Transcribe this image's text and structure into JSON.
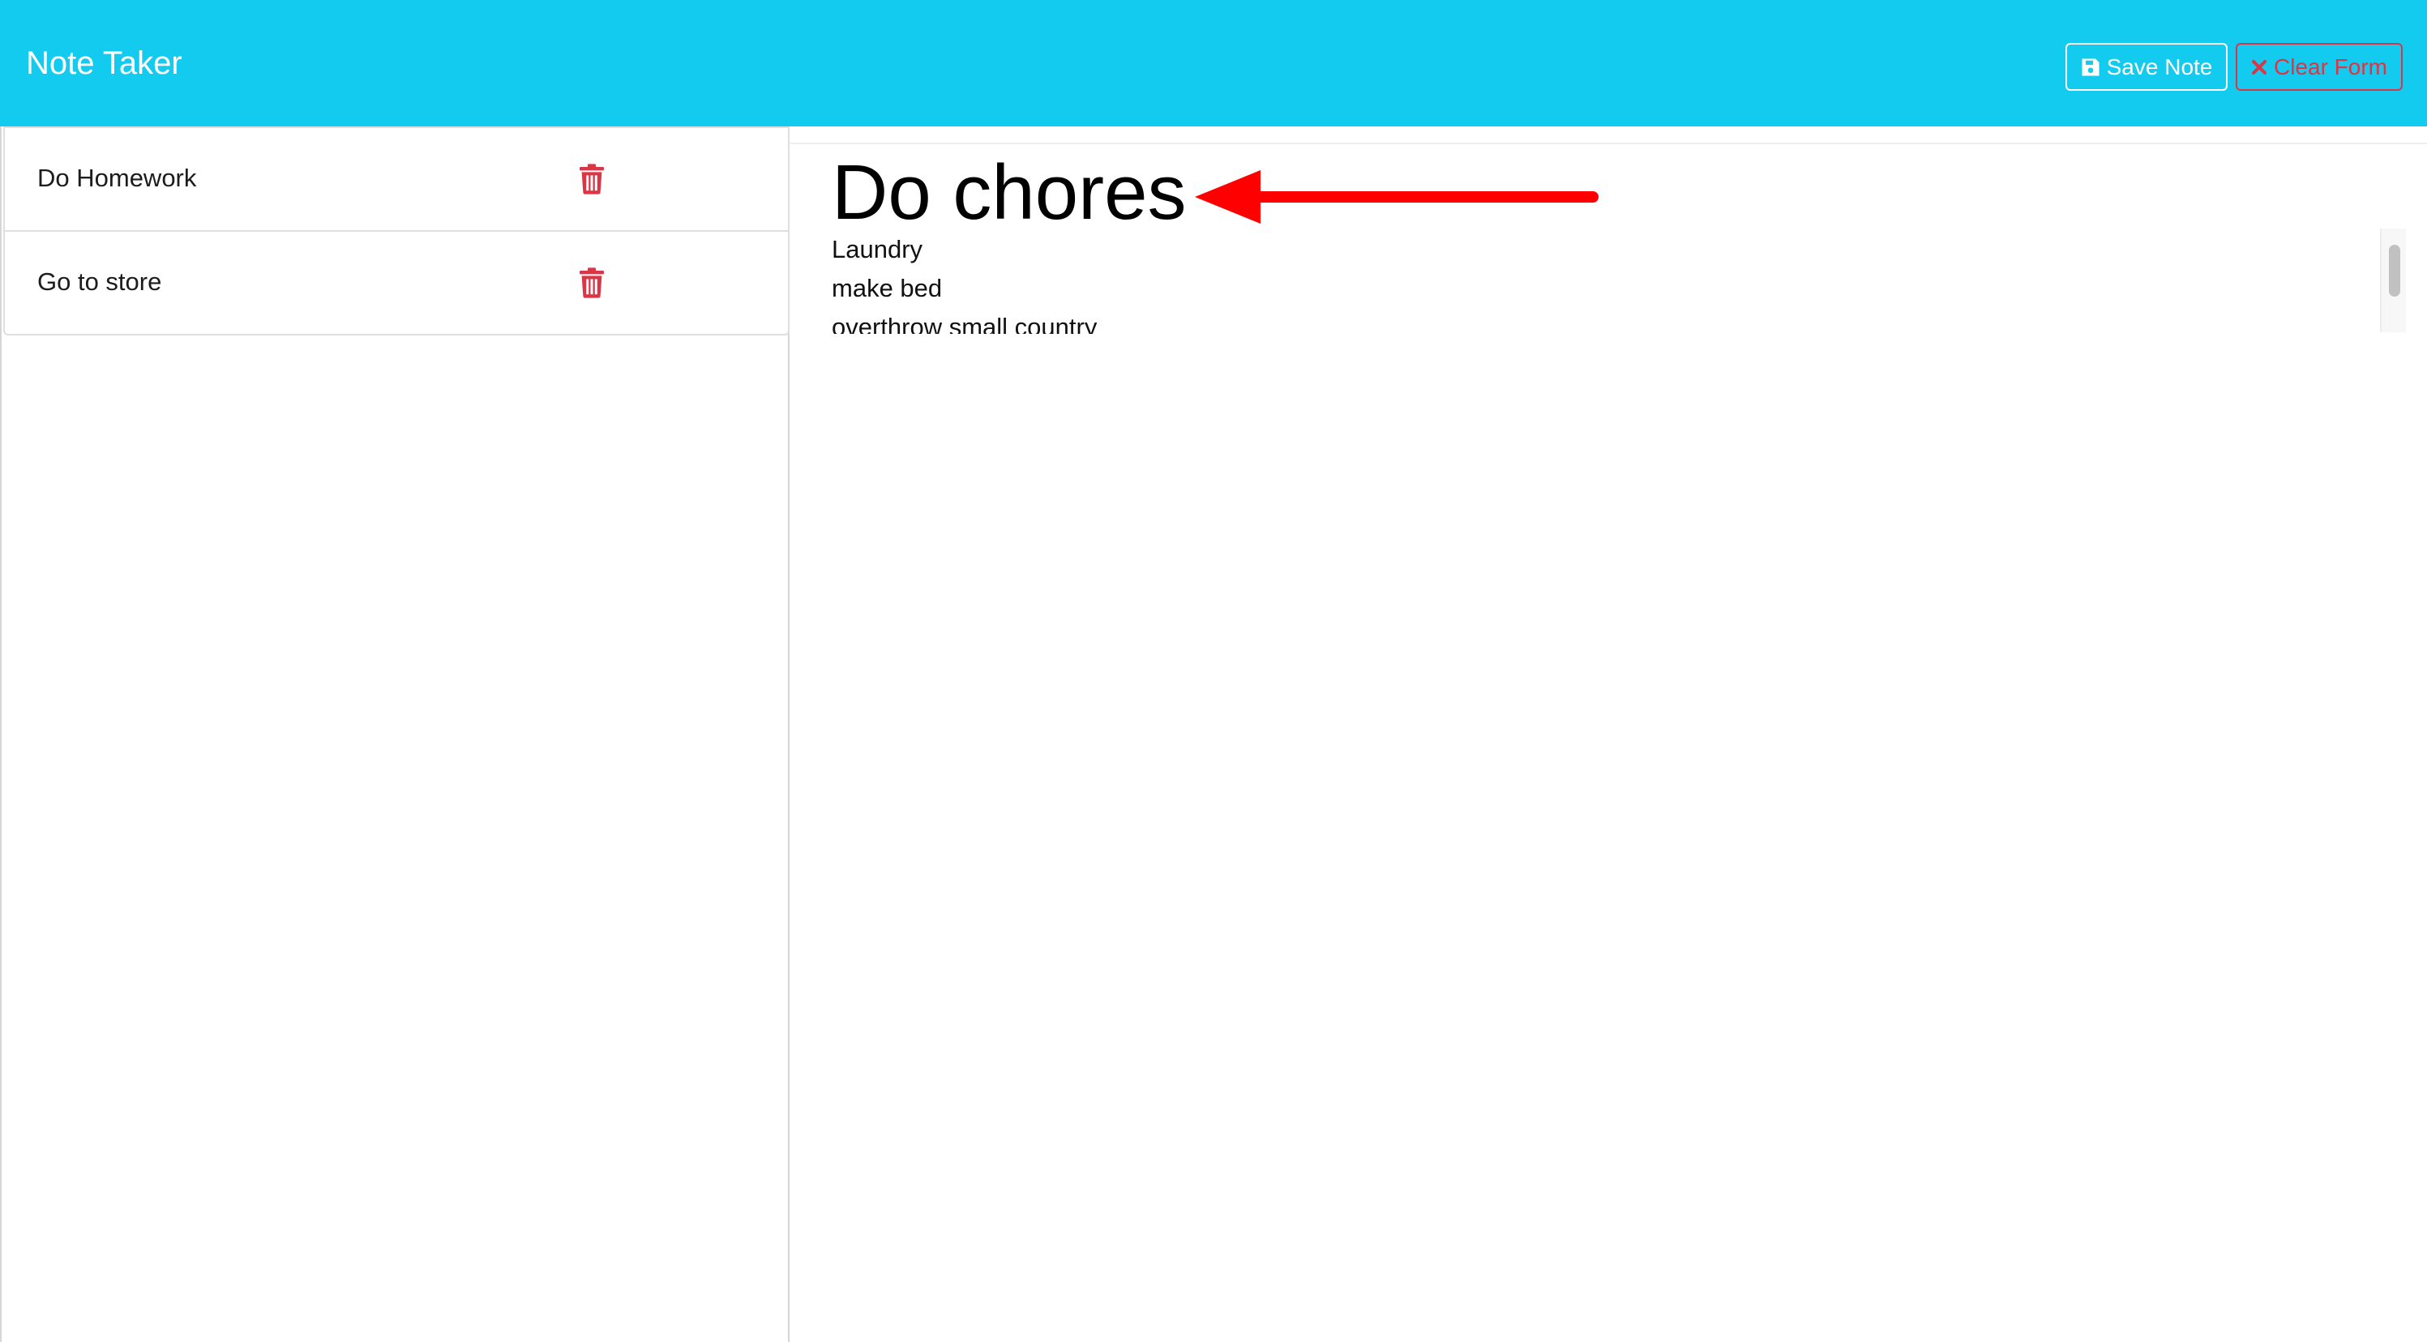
{
  "header": {
    "brand": "Note Taker",
    "save_label": "Save Note",
    "clear_label": "Clear Form"
  },
  "sidebar": {
    "notes": [
      {
        "title": "Do Homework"
      },
      {
        "title": "Go to store"
      }
    ]
  },
  "editor": {
    "title_value": "Do chores",
    "body_value": "Laundry\nmake bed\noverthrow small country"
  },
  "colors": {
    "navbar": "#13cbef",
    "danger": "#dc3545",
    "annotation_arrow": "#ff0000"
  },
  "icons": {
    "save": "floppy-disk-icon",
    "clear": "close-icon",
    "delete": "trash-icon"
  }
}
